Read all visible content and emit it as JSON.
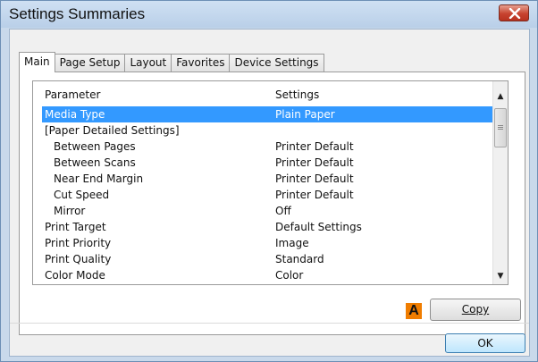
{
  "window": {
    "title": "Settings Summaries"
  },
  "tabs": [
    {
      "label": "Main",
      "active": true
    },
    {
      "label": "Page Setup",
      "active": false
    },
    {
      "label": "Layout",
      "active": false
    },
    {
      "label": "Favorites",
      "active": false
    },
    {
      "label": "Device Settings",
      "active": false
    }
  ],
  "list": {
    "headers": {
      "parameter": "Parameter",
      "settings": "Settings"
    },
    "rows": [
      {
        "parameter": "Media Type",
        "setting": "Plain Paper",
        "selected": true
      },
      {
        "parameter": "[Paper Detailed Settings]",
        "setting": ""
      },
      {
        "parameter": "Between Pages",
        "setting": "Printer Default"
      },
      {
        "parameter": "Between Scans",
        "setting": "Printer Default"
      },
      {
        "parameter": "Near End Margin",
        "setting": "Printer Default"
      },
      {
        "parameter": "Cut Speed",
        "setting": "Printer Default"
      },
      {
        "parameter": "Mirror",
        "setting": "Off"
      },
      {
        "parameter": "Print Target",
        "setting": "Default Settings"
      },
      {
        "parameter": "Print Priority",
        "setting": "Image"
      },
      {
        "parameter": "Print Quality",
        "setting": "Standard"
      },
      {
        "parameter": "Color Mode",
        "setting": "Color"
      }
    ]
  },
  "annotation_badge": "A",
  "buttons": {
    "copy": "Copy",
    "ok": "OK"
  },
  "colors": {
    "selection": "#3399ff",
    "badge": "#f07d00",
    "close_button": "#c7432f"
  },
  "icons": {
    "close": "close-icon",
    "scroll_up": "scroll-up-arrow-icon",
    "scroll_down": "scroll-down-arrow-icon"
  }
}
